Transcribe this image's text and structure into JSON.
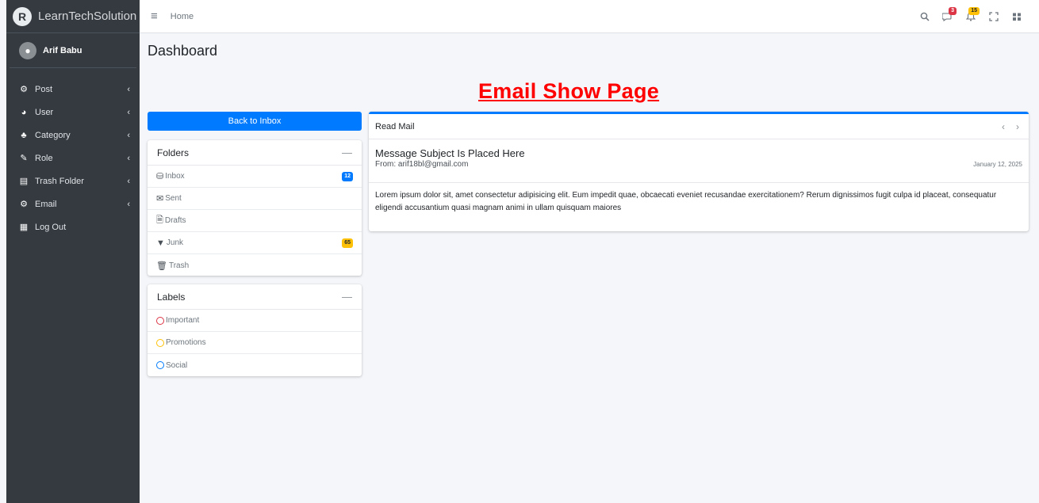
{
  "brand": {
    "name": "LearnTechSolution",
    "logo": "R"
  },
  "user": {
    "name": "Arif Babu"
  },
  "sidebar": {
    "items": [
      {
        "label": "Post",
        "icon": "tachometer-icon",
        "glyph": "⚙",
        "has_children": true
      },
      {
        "label": "User",
        "icon": "chart-pie-icon",
        "glyph": "◕",
        "has_children": true
      },
      {
        "label": "Category",
        "icon": "tree-icon",
        "glyph": "♣",
        "has_children": true
      },
      {
        "label": "Role",
        "icon": "edit-icon",
        "glyph": "✎",
        "has_children": true
      },
      {
        "label": "Trash Folder",
        "icon": "file-icon",
        "glyph": "▤",
        "has_children": true
      },
      {
        "label": "Email",
        "icon": "tachometer-icon",
        "glyph": "⚙",
        "has_children": true
      },
      {
        "label": "Log Out",
        "icon": "grid-icon",
        "glyph": "▦",
        "has_children": false
      }
    ],
    "chevron": "‹"
  },
  "topbar": {
    "home": "Home",
    "messages_badge": "3",
    "notifications_badge": "15"
  },
  "page": {
    "title": "Dashboard",
    "heading": "Email Show Page"
  },
  "back_button": "Back to Inbox",
  "folders": {
    "title": "Folders",
    "collapse": "—",
    "items": [
      {
        "label": "Inbox",
        "glyph": "⛁",
        "badge": "12",
        "badge_color": "#007bff"
      },
      {
        "label": "Sent",
        "glyph": "✉",
        "badge": ""
      },
      {
        "label": "Drafts",
        "glyph": "🗎",
        "badge": ""
      },
      {
        "label": "Junk",
        "glyph": "▼",
        "badge": "65",
        "badge_color": "#ffc107"
      },
      {
        "label": "Trash",
        "glyph": "🗑",
        "badge": ""
      }
    ]
  },
  "labels": {
    "title": "Labels",
    "collapse": "—",
    "items": [
      {
        "label": "Important",
        "color": "#dc3545"
      },
      {
        "label": "Promotions",
        "color": "#ffc107"
      },
      {
        "label": "Social",
        "color": "#007bff"
      }
    ]
  },
  "mail": {
    "header": "Read Mail",
    "prev": "‹",
    "next": "›",
    "subject": "Message Subject Is Placed Here",
    "from": "From: arif18bl@gmail.com",
    "date": "January 12, 2025",
    "body": "Lorem ipsum dolor sit, amet consectetur adipisicing elit. Eum impedit quae, obcaecati eveniet recusandae exercitationem? Rerum dignissimos fugit culpa id placeat, consequatur eligendi accusantium quasi magnam animi in ullam quisquam maiores"
  }
}
